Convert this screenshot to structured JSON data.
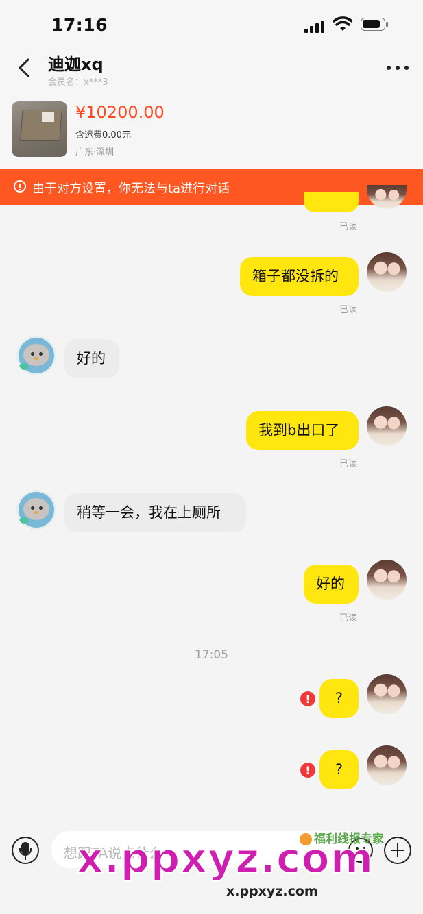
{
  "status_bar": {
    "time": "17:16"
  },
  "header": {
    "title": "迪迦xq",
    "member": "会员名：x***3"
  },
  "product": {
    "price": "¥10200.00",
    "shipping": "含运费0.00元",
    "location": "广东·深圳"
  },
  "banner": {
    "text": "由于对方设置，你无法与ta进行对话"
  },
  "messages": [
    {
      "from": "me",
      "text": "",
      "status": "已读"
    },
    {
      "from": "me",
      "text": "箱子都没拆的",
      "status": "已读"
    },
    {
      "from": "them",
      "text": "好的"
    },
    {
      "from": "me",
      "text": "我到b出口了",
      "status": "已读"
    },
    {
      "from": "them",
      "text": "稍等一会，我在上厕所"
    },
    {
      "from": "me",
      "text": "好的",
      "status": "已读"
    },
    {
      "from": "me",
      "text": "?",
      "failed": true,
      "failed_icon": "!"
    },
    {
      "from": "me",
      "text": "?",
      "failed": true,
      "failed_icon": "!"
    }
  ],
  "timestamp": "17:05",
  "composer": {
    "placeholder": "想跟TA说点什么"
  },
  "watermark": {
    "main": "x.ppxyz.com",
    "sub": "x.ppxyz.com",
    "brand": "福利线报专家"
  },
  "colors": {
    "accent": "#ff5722",
    "price": "#ff4b1f",
    "my_bubble": "#ffe60f",
    "their_bubble": "#ececec",
    "error": "#f03a3a"
  }
}
